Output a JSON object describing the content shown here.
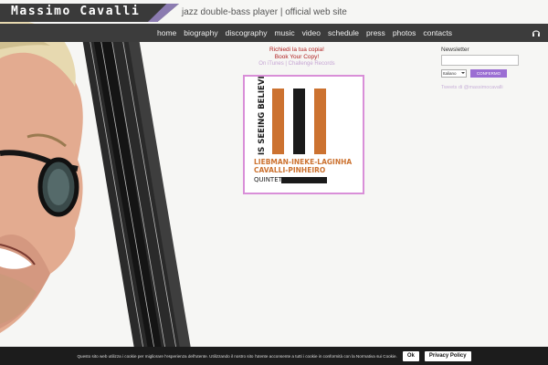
{
  "header": {
    "site_name": "Massimo Cavalli",
    "tagline": "jazz double-bass player | official web site"
  },
  "nav": {
    "items": [
      "home",
      "biography",
      "discography",
      "music",
      "video",
      "schedule",
      "press",
      "photos",
      "contacts"
    ],
    "headphones_icon": "headphones-icon"
  },
  "promo": {
    "line1": "Richiedi la tua copia!",
    "line2": "Book Your Copy!",
    "store_line": "On iTunes | Challenge Records"
  },
  "album": {
    "title": "IS SEEING BELIEVING ?",
    "artists_line1": "LIEBMAN-INEKE-LAGINHA",
    "artists_line2": "CAVALLI-PINHEIRO",
    "group": "QUINTET",
    "colors": {
      "orange": "#cc7230",
      "black": "#1a1a1a"
    }
  },
  "newsletter": {
    "label": "Newsletter",
    "email_value": "",
    "language_value": "Italiano",
    "submit_label": "CONFERMO",
    "tweets_link": "Tweets di @massimocavalli"
  },
  "cookie_bar": {
    "text": "Questo sito web utilizza i cookie per migliorare l'esperienza dell'utente. Utilizzando il nostro sito l'utente acconsente a tutti i cookie in conformità con la Normativa sui Cookie.",
    "ok_label": "Ok",
    "privacy_label": "Privacy Policy"
  },
  "colors": {
    "accent_purple": "#8b7bb0",
    "nav_bg": "#3c3c3c",
    "promo_red": "#b02020",
    "album_border": "#d98fd8"
  }
}
